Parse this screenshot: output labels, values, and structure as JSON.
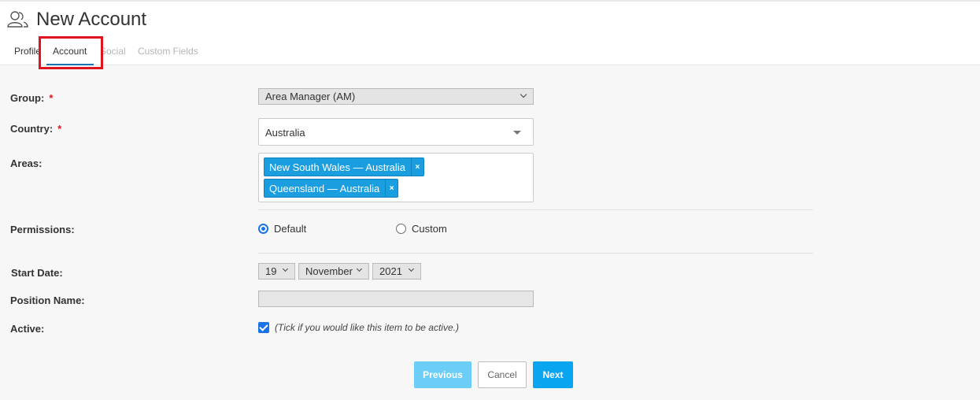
{
  "header": {
    "title": "New Account",
    "icon": "users-icon"
  },
  "tabs": [
    {
      "label": "Profile",
      "state": "default"
    },
    {
      "label": "Account",
      "state": "active"
    },
    {
      "label": "Social",
      "state": "disabled"
    },
    {
      "label": "Custom Fields",
      "state": "disabled"
    }
  ],
  "form": {
    "group": {
      "label": "Group:",
      "required_mark": "*",
      "value": "Area Manager (AM)"
    },
    "country": {
      "label": "Country:",
      "required_mark": "*",
      "value": "Australia"
    },
    "areas": {
      "label": "Areas:",
      "tags": [
        "New South Wales — Australia",
        "Queensland — Australia"
      ],
      "remove_glyph": "×"
    },
    "permissions": {
      "label": "Permissions:",
      "options": [
        "Default",
        "Custom"
      ],
      "selected": "Default"
    },
    "start_date": {
      "label": "Start Date:",
      "day": "19",
      "month": "November",
      "year": "2021"
    },
    "position_name": {
      "label": "Position Name:",
      "value": ""
    },
    "active": {
      "label": "Active:",
      "checked": true,
      "hint": "(Tick if you would like this item to be active.)"
    }
  },
  "buttons": {
    "previous": "Previous",
    "cancel": "Cancel",
    "next": "Next"
  },
  "colors": {
    "accent": "#1a73e8",
    "tag_bg": "#1a9ee0",
    "next_btn": "#0aa5f0",
    "prev_btn_disabled": "#6ccdf7",
    "highlight": "#e0141e"
  }
}
